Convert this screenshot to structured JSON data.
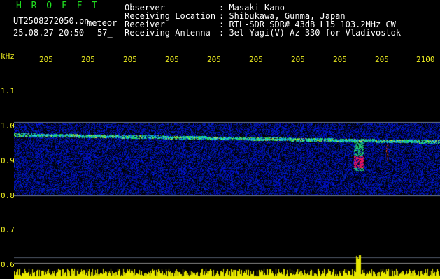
{
  "header": {
    "app_name": "H R O F F T",
    "filename": "UT2508272050.pn",
    "mode": "meteor",
    "datetime": "25.08.27 20:50",
    "count": "57_",
    "meta": [
      {
        "label": "Observer",
        "value": ": Masaki Kano"
      },
      {
        "label": "Receiving Location",
        "value": ": Shibukawa, Gunma, Japan"
      },
      {
        "label": "Receiver",
        "value": ": RTL-SDR SDR# 43dB L15 103.2MHz CW"
      },
      {
        "label": "Receiving Antenna",
        "value": ": 3el Yagi(V) Az 330 for Vladivostok"
      }
    ]
  },
  "axes": {
    "y_unit": "kHz",
    "y_ticks": [
      "1.1",
      "1.0",
      "0.9",
      "0.8",
      "0.7",
      "0.6"
    ],
    "x_ticks": [
      "205",
      "205",
      "205",
      "205",
      "205",
      "205",
      "205",
      "205",
      "205",
      "2100"
    ]
  },
  "colors": {
    "background": "#000000",
    "axis_text": "#f0f020",
    "header_text": "#ffffff",
    "title_green": "#20e020",
    "grid": "#909090",
    "spectrum_bars": "#e8e800"
  }
}
